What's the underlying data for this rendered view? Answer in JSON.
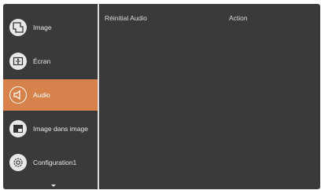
{
  "sidebar": {
    "items": [
      {
        "label": "Image",
        "icon": "image-icon"
      },
      {
        "label": "Écran",
        "icon": "screen-icon"
      },
      {
        "label": "Audio",
        "icon": "speaker-icon"
      },
      {
        "label": "Image dans image",
        "icon": "pip-icon"
      },
      {
        "label": "Configuration1",
        "icon": "settings-gear-icon"
      }
    ],
    "active_index": 2
  },
  "content": {
    "row_label": "Réinitial Audio",
    "row_value": "Action"
  },
  "colors": {
    "panel_bg": "#3a3a3a",
    "active_bg": "#d6824a",
    "text": "#e6e6e6"
  }
}
